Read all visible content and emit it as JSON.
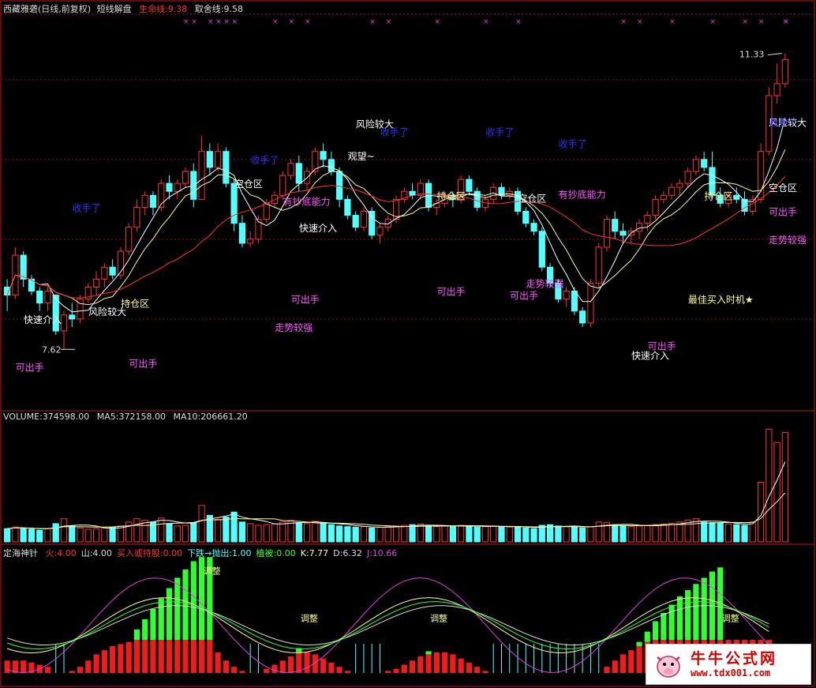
{
  "main_panel": {
    "title": "西藏雅砻(日线,前复权)",
    "indicator_name": "短线解盘",
    "lifeline_label": "生命线:9.38",
    "takeoff_label": "取舍线:9.58",
    "high_marker": "11.33",
    "low_marker": "7.62",
    "colors": {
      "up": "#ff3232",
      "down": "#54ffff",
      "ma_white": "#ffffff",
      "ma_yellow": "#ffff9a",
      "ma_red": "#ff3232"
    }
  },
  "volume_panel": {
    "title": "VOLUME:374598.00",
    "ma5": "MA5:372158.00",
    "ma10": "MA10:206661.20"
  },
  "bottom_panel": {
    "name": "定海神针",
    "labels": [
      {
        "text": "火:4.00",
        "color": "#ff3232"
      },
      {
        "text": "山:4.00",
        "color": "#dddddd"
      },
      {
        "text": "买入或持股:0.00",
        "color": "#ff3232"
      },
      {
        "text": "下跌→抛出:1.00",
        "color": "#54ffff"
      },
      {
        "text": "植被:0.00",
        "color": "#32ff32"
      },
      {
        "text": "K:7.77",
        "color": "#ffff9a"
      },
      {
        "text": "D:6.32",
        "color": "#dddddd"
      },
      {
        "text": "J:10.66",
        "color": "#e040e0"
      }
    ]
  },
  "watermark": {
    "title": "牛牛公式网",
    "url": "www.tdx001.com"
  },
  "chart_data": [
    {
      "type": "candlestick",
      "title": "西藏雅砻(日线,前复权) 短线解盘",
      "x_count": 100,
      "ylim": [
        6.9,
        11.8
      ],
      "grid": "horizontal dashed",
      "annotated_high": 11.33,
      "annotated_low": 7.62,
      "ohlc": [
        [
          8.4,
          8.5,
          8.1,
          8.3
        ],
        [
          8.3,
          8.9,
          8.25,
          8.8
        ],
        [
          8.8,
          8.85,
          8.4,
          8.5
        ],
        [
          8.5,
          8.55,
          8.3,
          8.35
        ],
        [
          8.35,
          8.4,
          8.1,
          8.2
        ],
        [
          8.2,
          8.4,
          8.1,
          8.35
        ],
        [
          8.3,
          8.3,
          7.8,
          7.85
        ],
        [
          7.85,
          8.1,
          7.62,
          8.05
        ],
        [
          8.05,
          8.2,
          7.9,
          8.0
        ],
        [
          8.0,
          8.3,
          7.95,
          8.25
        ],
        [
          8.25,
          8.45,
          8.2,
          8.4
        ],
        [
          8.4,
          8.6,
          8.3,
          8.5
        ],
        [
          8.5,
          8.7,
          8.4,
          8.65
        ],
        [
          8.65,
          8.75,
          8.5,
          8.55
        ],
        [
          8.55,
          8.9,
          8.5,
          8.85
        ],
        [
          8.85,
          9.2,
          8.8,
          9.15
        ],
        [
          9.15,
          9.5,
          9.1,
          9.4
        ],
        [
          9.4,
          9.6,
          9.3,
          9.55
        ],
        [
          9.55,
          9.6,
          9.3,
          9.4
        ],
        [
          9.4,
          9.75,
          9.35,
          9.7
        ],
        [
          9.7,
          9.8,
          9.5,
          9.6
        ],
        [
          9.6,
          9.75,
          9.5,
          9.7
        ],
        [
          9.7,
          9.9,
          9.65,
          9.85
        ],
        [
          9.85,
          9.95,
          9.4,
          9.5
        ],
        [
          9.5,
          10.3,
          9.5,
          10.1
        ],
        [
          10.1,
          10.2,
          9.8,
          9.9
        ],
        [
          9.9,
          10.2,
          9.85,
          10.1
        ],
        [
          10.1,
          10.15,
          9.65,
          9.7
        ],
        [
          9.7,
          9.75,
          9.1,
          9.2
        ],
        [
          9.2,
          9.3,
          8.9,
          8.95
        ],
        [
          8.95,
          9.1,
          8.9,
          9.0
        ],
        [
          9.0,
          9.3,
          8.95,
          9.25
        ],
        [
          9.25,
          9.5,
          9.2,
          9.45
        ],
        [
          9.45,
          9.6,
          9.4,
          9.55
        ],
        [
          9.55,
          9.85,
          9.5,
          9.8
        ],
        [
          9.8,
          10.0,
          9.75,
          9.95
        ],
        [
          9.95,
          10.05,
          9.6,
          9.7
        ],
        [
          9.7,
          9.9,
          9.6,
          9.85
        ],
        [
          9.85,
          10.15,
          9.8,
          10.1
        ],
        [
          10.1,
          10.2,
          9.9,
          10.0
        ],
        [
          10.0,
          10.1,
          9.8,
          9.85
        ],
        [
          9.85,
          9.9,
          9.4,
          9.5
        ],
        [
          9.5,
          9.55,
          9.25,
          9.3
        ],
        [
          9.3,
          9.35,
          9.1,
          9.15
        ],
        [
          9.15,
          9.4,
          9.1,
          9.35
        ],
        [
          9.35,
          9.4,
          9.0,
          9.05
        ],
        [
          9.05,
          9.2,
          8.95,
          9.15
        ],
        [
          9.15,
          9.3,
          9.1,
          9.25
        ],
        [
          9.25,
          9.55,
          9.2,
          9.5
        ],
        [
          9.5,
          9.65,
          9.45,
          9.6
        ],
        [
          9.6,
          9.7,
          9.5,
          9.55
        ],
        [
          9.55,
          9.75,
          9.5,
          9.7
        ],
        [
          9.7,
          9.75,
          9.35,
          9.4
        ],
        [
          9.4,
          9.5,
          9.3,
          9.45
        ],
        [
          9.45,
          9.6,
          9.4,
          9.55
        ],
        [
          9.55,
          9.6,
          9.4,
          9.5
        ],
        [
          9.5,
          9.8,
          9.45,
          9.75
        ],
        [
          9.75,
          9.8,
          9.55,
          9.6
        ],
        [
          9.6,
          9.65,
          9.35,
          9.4
        ],
        [
          9.4,
          9.55,
          9.35,
          9.5
        ],
        [
          9.5,
          9.7,
          9.45,
          9.65
        ],
        [
          9.65,
          9.7,
          9.5,
          9.55
        ],
        [
          9.55,
          9.65,
          9.5,
          9.6
        ],
        [
          9.6,
          9.65,
          9.3,
          9.35
        ],
        [
          9.35,
          9.4,
          9.15,
          9.2
        ],
        [
          9.2,
          9.25,
          9.05,
          9.1
        ],
        [
          9.1,
          9.15,
          8.6,
          8.65
        ],
        [
          8.65,
          8.7,
          8.4,
          8.45
        ],
        [
          8.45,
          8.5,
          8.2,
          8.25
        ],
        [
          8.25,
          8.4,
          8.15,
          8.35
        ],
        [
          8.35,
          8.4,
          8.05,
          8.1
        ],
        [
          8.1,
          8.15,
          7.9,
          7.95
        ],
        [
          7.95,
          8.5,
          7.9,
          8.45
        ],
        [
          8.45,
          8.95,
          8.4,
          8.9
        ],
        [
          8.9,
          9.3,
          8.85,
          9.25
        ],
        [
          9.25,
          9.35,
          9.0,
          9.1
        ],
        [
          9.1,
          9.2,
          8.95,
          9.05
        ],
        [
          9.05,
          9.15,
          8.95,
          9.1
        ],
        [
          9.1,
          9.25,
          9.0,
          9.2
        ],
        [
          9.2,
          9.35,
          9.1,
          9.3
        ],
        [
          9.3,
          9.55,
          9.25,
          9.5
        ],
        [
          9.5,
          9.6,
          9.45,
          9.55
        ],
        [
          9.55,
          9.7,
          9.5,
          9.65
        ],
        [
          9.65,
          9.75,
          9.55,
          9.7
        ],
        [
          9.7,
          9.9,
          9.65,
          9.85
        ],
        [
          9.85,
          10.05,
          9.8,
          10.0
        ],
        [
          10.0,
          10.1,
          9.85,
          9.9
        ],
        [
          9.9,
          10.1,
          9.5,
          9.55
        ],
        [
          9.55,
          9.65,
          9.4,
          9.45
        ],
        [
          9.45,
          9.6,
          9.4,
          9.55
        ],
        [
          9.55,
          9.65,
          9.45,
          9.5
        ],
        [
          9.5,
          9.6,
          9.3,
          9.35
        ],
        [
          9.35,
          9.55,
          9.3,
          9.5
        ],
        [
          9.5,
          10.2,
          9.45,
          10.1
        ],
        [
          10.1,
          10.9,
          10.05,
          10.8
        ],
        [
          10.8,
          11.2,
          10.7,
          10.95
        ],
        [
          10.95,
          11.33,
          10.9,
          11.25
        ]
      ],
      "annotations": [
        {
          "text": "快速介入",
          "i": 3,
          "y": 7.95,
          "color": "#ffffff"
        },
        {
          "text": "风险较大",
          "i": 11,
          "y": 8.05,
          "color": "#ffffff"
        },
        {
          "text": "持仓区",
          "i": 15,
          "y": 8.15,
          "color": "#ffff9a"
        },
        {
          "text": "收手了",
          "i": 9,
          "y": 9.35,
          "color": "#3030ff"
        },
        {
          "text": "可出手",
          "i": 2,
          "y": 7.35,
          "color": "#ff55ff"
        },
        {
          "text": "可出手",
          "i": 16,
          "y": 7.4,
          "color": "#ff55ff"
        },
        {
          "text": "空仓区",
          "i": 29,
          "y": 9.65,
          "color": "#ffffff"
        },
        {
          "text": "收手了",
          "i": 31,
          "y": 9.95,
          "color": "#3030ff"
        },
        {
          "text": "有抄底能力",
          "i": 35,
          "y": 9.43,
          "color": "#ff55ff"
        },
        {
          "text": "快速介入",
          "i": 37,
          "y": 9.1,
          "color": "#ffffff"
        },
        {
          "text": "可出手",
          "i": 36,
          "y": 8.2,
          "color": "#ff55ff"
        },
        {
          "text": "走势较强",
          "i": 34,
          "y": 7.85,
          "color": "#ff55ff"
        },
        {
          "text": "观望~",
          "i": 43,
          "y": 10.0,
          "color": "#ffffff"
        },
        {
          "text": "风险较大",
          "i": 44,
          "y": 10.4,
          "color": "#ffffff"
        },
        {
          "text": "收手了",
          "i": 47,
          "y": 10.3,
          "color": "#3030ff"
        },
        {
          "text": "持仓区",
          "i": 54,
          "y": 9.5,
          "color": "#ffff9a"
        },
        {
          "text": "可出手",
          "i": 54,
          "y": 8.3,
          "color": "#ff55ff"
        },
        {
          "text": "收手了",
          "i": 60,
          "y": 10.3,
          "color": "#3030ff"
        },
        {
          "text": "空仓区",
          "i": 64,
          "y": 9.47,
          "color": "#ffffff"
        },
        {
          "text": "有抄底能力",
          "i": 69,
          "y": 9.52,
          "color": "#ff55ff"
        },
        {
          "text": "走势较强",
          "i": 65,
          "y": 8.4,
          "color": "#ff55ff"
        },
        {
          "text": "可出手",
          "i": 63,
          "y": 8.25,
          "color": "#ff55ff"
        },
        {
          "text": "收手了",
          "i": 69,
          "y": 10.15,
          "color": "#3030ff"
        },
        {
          "text": "最佳买入时机★",
          "i": 85,
          "y": 8.2,
          "color": "#ffff9a"
        },
        {
          "text": "快速介入",
          "i": 78,
          "y": 7.5,
          "color": "#ffffff"
        },
        {
          "text": "可出手",
          "i": 80,
          "y": 7.62,
          "color": "#ff55ff"
        },
        {
          "text": "持仓区",
          "i": 87,
          "y": 9.5,
          "color": "#ffff9a"
        },
        {
          "text": "空仓区",
          "i": 95,
          "y": 9.6,
          "color": "#ffffff"
        },
        {
          "text": "风险较大",
          "i": 96,
          "y": 10.42,
          "color": "#ffffff"
        },
        {
          "text": "收手了",
          "i": 99,
          "y": 10.42,
          "color": "#3030ff"
        },
        {
          "text": "走势较强",
          "i": 98,
          "y": 8.95,
          "color": "#ff55ff"
        },
        {
          "text": "可出手",
          "i": 104,
          "y": 9.3,
          "color": "#ff55ff"
        }
      ]
    },
    {
      "type": "bar",
      "title": "VOLUME",
      "values": [
        40,
        45,
        42,
        38,
        35,
        40,
        55,
        70,
        48,
        42,
        38,
        40,
        42,
        44,
        48,
        60,
        70,
        65,
        60,
        72,
        55,
        48,
        50,
        58,
        110,
        80,
        68,
        75,
        90,
        60,
        55,
        50,
        52,
        54,
        60,
        65,
        58,
        55,
        62,
        56,
        52,
        48,
        46,
        44,
        46,
        42,
        44,
        46,
        48,
        50,
        52,
        54,
        48,
        46,
        48,
        46,
        50,
        48,
        44,
        46,
        48,
        46,
        45,
        44,
        42,
        40,
        50,
        52,
        48,
        46,
        44,
        42,
        46,
        60,
        58,
        52,
        48,
        46,
        48,
        50,
        52,
        54,
        56,
        60,
        66,
        70,
        60,
        58,
        56,
        54,
        52,
        50,
        60,
        180,
        340,
        300,
        330
      ],
      "ylim": [
        0,
        360
      ]
    },
    {
      "type": "bar",
      "title": "定海神针",
      "series": [
        {
          "name": "火",
          "values": [
            0.6,
            0.6,
            0.6,
            0.5,
            0.4,
            0.3,
            0,
            0,
            0.1,
            0.3,
            0.6,
            0.9,
            1.1,
            1.3,
            1.4,
            1.5,
            1.6,
            1.6,
            1.6,
            1.6,
            1.6,
            1.6,
            1.6,
            1.6,
            1.6,
            1.6,
            1.0,
            0.6,
            0.3,
            0.1,
            0,
            0,
            0.2,
            0.4,
            0.6,
            0.8,
            1.0,
            1.0,
            0.9,
            0.7,
            0.5,
            0.3,
            0.1,
            0,
            0,
            0,
            0,
            0.1,
            0.2,
            0.4,
            0.6,
            0.8,
            0.9,
            1.0,
            1.0,
            0.9,
            0.7,
            0.5,
            0.3,
            0.1,
            0,
            0,
            0,
            0,
            0,
            0,
            0,
            0,
            0,
            0,
            0,
            0,
            0,
            0,
            0.3,
            0.6,
            0.9,
            1.1,
            1.3,
            1.5,
            1.6,
            1.6,
            1.6,
            1.6,
            1.6,
            1.6,
            1.6,
            1.6,
            1.6,
            1.6,
            1.6,
            1.6,
            1.6,
            1.6,
            1.6
          ]
        },
        {
          "name": "山",
          "values": [
            0,
            0,
            0,
            0,
            0,
            0,
            0,
            0,
            0,
            0,
            0,
            0,
            0,
            0,
            0,
            0,
            0.5,
            1.0,
            1.5,
            2.0,
            2.5,
            3.0,
            3.4,
            3.8,
            4.0,
            4.0,
            0,
            0,
            0,
            0,
            0,
            0,
            0,
            0,
            0,
            0,
            0.2,
            0,
            0,
            0,
            0,
            0,
            0,
            0,
            0,
            0,
            0,
            0,
            0,
            0,
            0,
            0,
            0.15,
            0,
            0,
            0,
            0,
            0,
            0,
            0,
            0,
            0,
            0,
            0,
            0,
            0,
            0,
            0,
            0,
            0,
            0,
            0,
            0,
            0,
            0,
            0,
            0,
            0,
            0.2,
            0.5,
            0.9,
            1.3,
            1.7,
            2.1,
            2.4,
            2.7,
            3.0,
            3.3,
            3.5,
            0,
            0,
            0,
            0,
            0,
            0
          ]
        }
      ]
    }
  ]
}
